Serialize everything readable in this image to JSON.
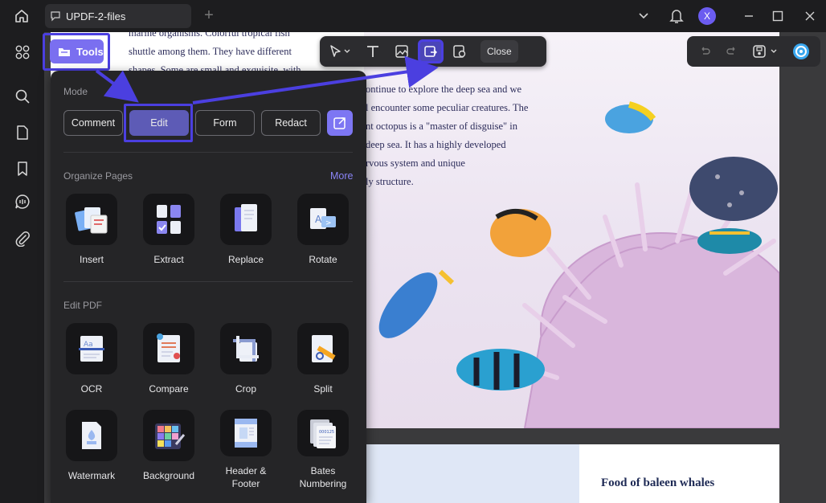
{
  "titlebar": {
    "tab_title": "UPDF-2-files",
    "avatar_letter": "X"
  },
  "document": {
    "left_lines": [
      "marine organisms. Colorful tropical fish",
      "shuttle among them. They have different",
      "shapes. Some are small and exquisite, with"
    ],
    "middle_lines": [
      "ontinue to explore the deep sea and we",
      "l encounter some peculiar creatures. The",
      "nt octopus is a \"master of disguise\" in",
      "deep sea. It has a highly developed",
      "rvous system and unique",
      "ly structure."
    ],
    "page2_heading": "Food of baleen whales"
  },
  "float_toolbar": {
    "close_label": "Close"
  },
  "tools_button": {
    "label": "Tools"
  },
  "panel": {
    "mode_label": "Mode",
    "modes": {
      "comment": "Comment",
      "edit": "Edit",
      "form": "Form",
      "redact": "Redact"
    },
    "organize_label": "Organize Pages",
    "more_label": "More",
    "organize_tools": {
      "insert": "Insert",
      "extract": "Extract",
      "replace": "Replace",
      "rotate": "Rotate"
    },
    "edit_pdf_label": "Edit PDF",
    "edit_tools": {
      "ocr": "OCR",
      "compare": "Compare",
      "crop": "Crop",
      "split": "Split",
      "watermark": "Watermark",
      "background": "Background",
      "header_footer_1": "Header &",
      "header_footer_2": "Footer",
      "bates_1": "Bates",
      "bates_2": "Numbering"
    }
  },
  "colors": {
    "accent": "#7a6ff0",
    "highlight": "#4b3fe0",
    "panel": "#252527"
  }
}
